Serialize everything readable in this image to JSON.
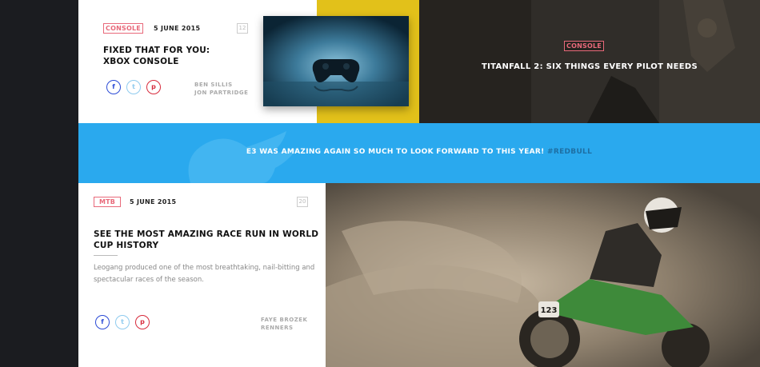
{
  "card1": {
    "tag": "CONSOLE",
    "date": "5 JUNE 2015",
    "count": "12",
    "title_line1": "FIXED THAT FOR YOU:",
    "title_line2": "XBOX CONSOLE",
    "author1": "BEN SILLIS",
    "author2": "JON PARTRIDGE",
    "social": {
      "facebook": "f",
      "twitter": "t",
      "pinterest": "p"
    }
  },
  "feature": {
    "tag": "CONSOLE",
    "title": "TITANFALL 2: SIX THINGS EVERY PILOT NEEDS"
  },
  "tweet": {
    "text": "E3 WAS AMAZING AGAIN SO MUCH TO LOOK FORWARD TO THIS YEAR!",
    "hashtag": "#REDBULL"
  },
  "card2": {
    "tag": "MTB",
    "date": "5 JUNE 2015",
    "count": "20",
    "title_line1": "SEE THE MOST AMAZING RACE RUN IN WORLD",
    "title_line2": "CUP HISTORY",
    "excerpt_line1": "Leogang produced one of the most breathtaking, nail-bitting and",
    "excerpt_line2": "spectacular races of the season.",
    "author1": "FAYE BROZEK",
    "author2": "RENNERS",
    "social": {
      "facebook": "f",
      "twitter": "t",
      "pinterest": "p"
    },
    "bike_number": "123"
  },
  "colors": {
    "accent_pink": "#e8697a",
    "twitter_blue": "#2aa9ee",
    "yellow": "#e2c11a",
    "dark_sidebar": "#1b1c20"
  }
}
